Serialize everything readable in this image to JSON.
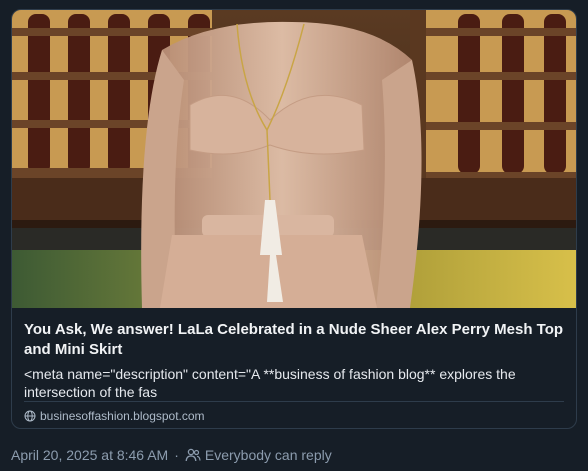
{
  "link_card": {
    "title": "You Ask, We answer! LaLa Celebrated in a Nude Sheer Alex Perry Mesh Top and Mini Skirt",
    "description": "<meta name=\"description\" content=\"A **business of fashion blog** explores the intersection of the fas",
    "domain": "businesoffashion.blogspot.com",
    "domain_icon": "globe-icon"
  },
  "post_meta": {
    "timestamp": "April 20, 2025 at 8:46 AM",
    "separator": "·",
    "reply_setting": "Everybody can reply",
    "reply_icon": "people-icon"
  },
  "colors": {
    "background": "#161e27",
    "card_border": "#2e3c4b",
    "title_text": "#f1f3f5",
    "secondary_text": "#8c9cae"
  }
}
